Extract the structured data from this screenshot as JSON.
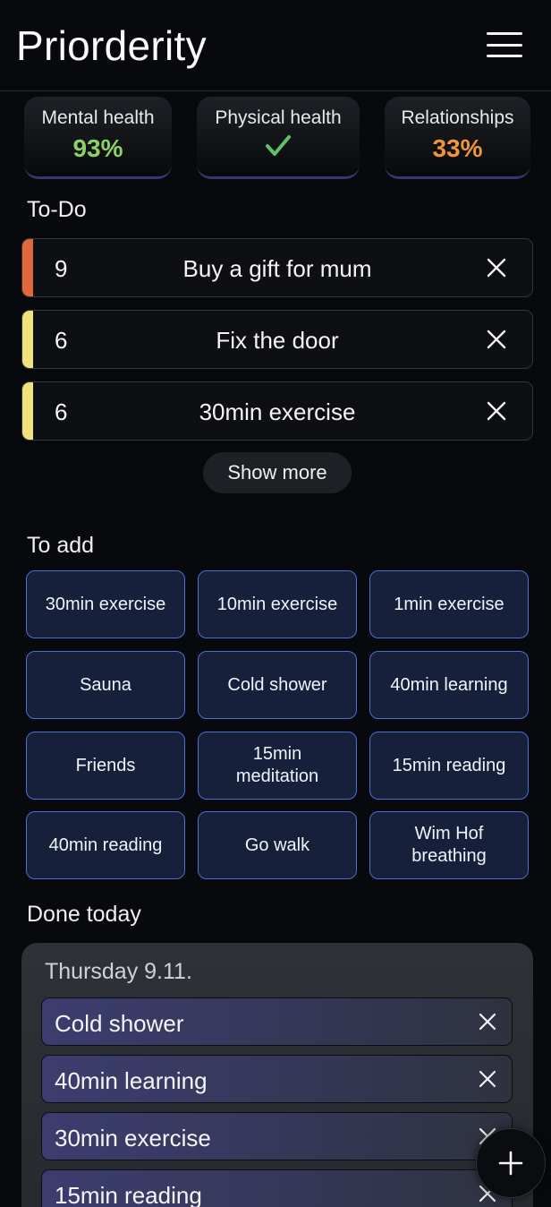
{
  "app": {
    "title": "Priorderity"
  },
  "stats": [
    {
      "label": "Mental health",
      "value": "93%",
      "color": "#8bd164"
    },
    {
      "label": "Physical health",
      "icon": "check-icon",
      "color": "#5fbf6a"
    },
    {
      "label": "Relationships",
      "value": "33%",
      "color": "#f0953a"
    }
  ],
  "todo": {
    "title": "To-Do",
    "items": [
      {
        "priority": "9",
        "title": "Buy a gift for mum",
        "color": "#e0683a"
      },
      {
        "priority": "6",
        "title": "Fix the door",
        "color": "#f1e37a"
      },
      {
        "priority": "6",
        "title": "30min exercise",
        "color": "#f1e37a"
      }
    ],
    "show_more": "Show more"
  },
  "to_add": {
    "title": "To add",
    "items": [
      "30min exercise",
      "10min exercise",
      "1min exercise",
      "Sauna",
      "Cold shower",
      "40min learning",
      "Friends",
      "15min meditation",
      "15min reading",
      "40min reading",
      "Go walk",
      "Wim Hof breathing"
    ]
  },
  "done": {
    "title": "Done today",
    "date": "Thursday 9.11.",
    "items": [
      "Cold shower",
      "40min learning",
      "30min exercise",
      "15min reading"
    ]
  }
}
